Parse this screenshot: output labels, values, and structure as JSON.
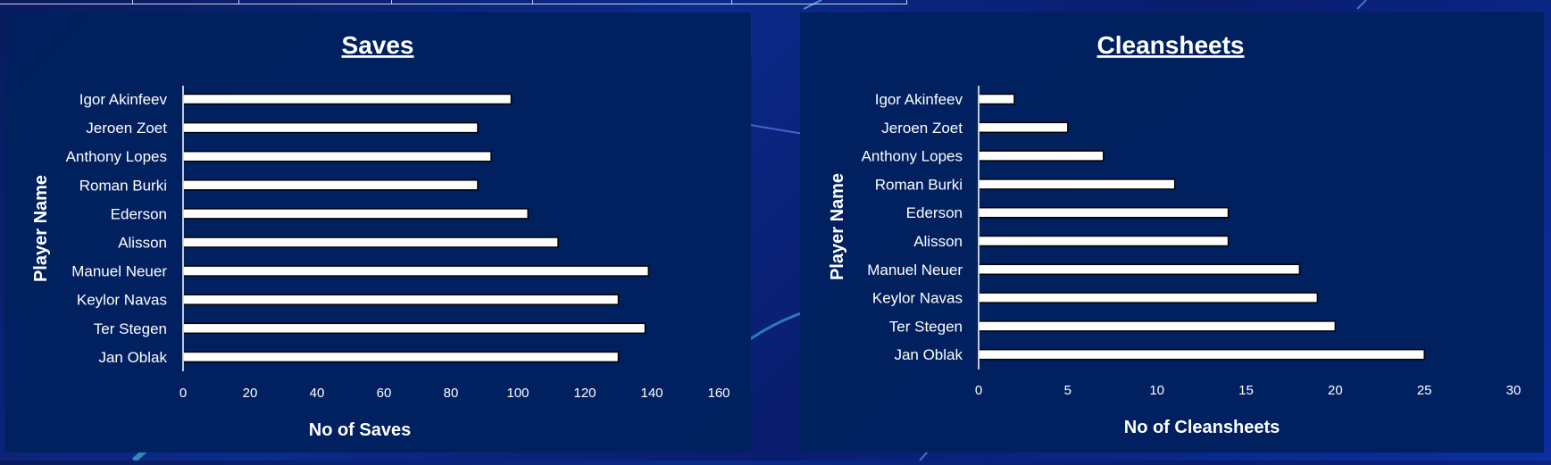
{
  "chart_data": [
    {
      "type": "bar",
      "orientation": "horizontal",
      "title": "Saves",
      "xlabel": "No of Saves",
      "ylabel": "Player Name",
      "categories": [
        "Igor Akinfeev",
        "Jeroen Zoet",
        "Anthony Lopes",
        "Roman Burki",
        "Ederson",
        "Alisson",
        "Manuel Neuer",
        "Keylor Navas",
        "Ter Stegen",
        "Jan Oblak"
      ],
      "values": [
        98,
        88,
        92,
        88,
        103,
        112,
        139,
        130,
        138,
        130
      ],
      "xlim": [
        0,
        160
      ],
      "xticks": [
        "0",
        "20",
        "40",
        "60",
        "80",
        "100",
        "120",
        "140",
        "160"
      ],
      "grid": false,
      "bar_color": "#ffffff",
      "bar_edge_color": "#000000"
    },
    {
      "type": "bar",
      "orientation": "horizontal",
      "title": "Cleansheets",
      "xlabel": "No of Cleansheets",
      "ylabel": "Player Name",
      "categories": [
        "Igor Akinfeev",
        "Jeroen Zoet",
        "Anthony Lopes",
        "Roman Burki",
        "Ederson",
        "Alisson",
        "Manuel Neuer",
        "Keylor Navas",
        "Ter Stegen",
        "Jan Oblak"
      ],
      "values": [
        2,
        5,
        7,
        11,
        14,
        14,
        18,
        19,
        20,
        25
      ],
      "xlim": [
        0,
        30
      ],
      "xticks": [
        "0",
        "5",
        "10",
        "15",
        "20",
        "25",
        "30"
      ],
      "grid": false,
      "bar_color": "#ffffff",
      "bar_edge_color": "#000000"
    }
  ],
  "colors": {
    "panel_background": "#00205e",
    "page_background": "#0a1d6e",
    "text": "#ffffff"
  }
}
